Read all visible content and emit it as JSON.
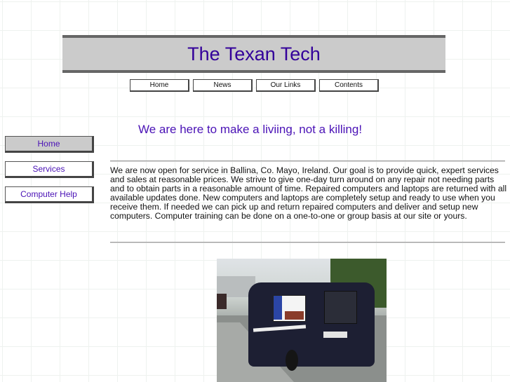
{
  "header": {
    "title": "The Texan Tech"
  },
  "top_nav": [
    {
      "label": "Home"
    },
    {
      "label": "News"
    },
    {
      "label": "Our Links"
    },
    {
      "label": "Contents"
    }
  ],
  "tagline": "We are here to make a liviing, not a killing!",
  "side_nav": [
    {
      "label": "Home",
      "active": true
    },
    {
      "label": "Services",
      "active": false
    },
    {
      "label": "Computer Help",
      "active": false
    }
  ],
  "content": {
    "paragraph": "We are now open for service in Ballina, Co. Mayo, Ireland. Our goal is to provide quick, expert services and sales at reasonable prices.  We strive to give one-day turn around on any repair not needing parts and to obtain parts in a reasonable amount of time. Repaired computers and laptops are returned with all available updates done. New computers and laptops are completely setup and ready to use when you receive them. If needed we can pick up and return repaired computers and deliver and setup new computers. Computer training can be done on a one-to-one or group basis at our site or yours."
  },
  "photo": {
    "description": "Company van with The Texan Tech Computer Services signage"
  },
  "colors": {
    "title": "#33009a",
    "accent_text": "#4a12b6",
    "banner_bg": "#cbcbcb",
    "banner_border": "#666666"
  }
}
